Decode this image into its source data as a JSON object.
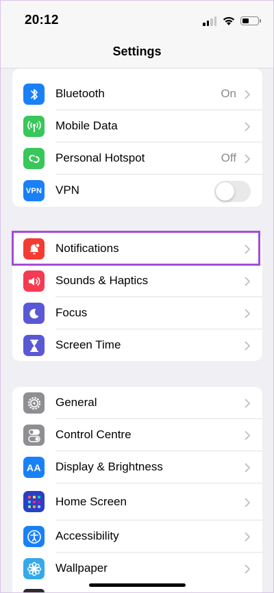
{
  "status_bar": {
    "time": "20:12",
    "icons": [
      "cellular-signal-icon",
      "wifi-icon",
      "battery-icon"
    ]
  },
  "nav": {
    "title": "Settings"
  },
  "groups": [
    {
      "rows": [
        {
          "label": "Bluetooth",
          "value": "On",
          "icon": "bluetooth-icon",
          "icon_color": "#1a80f7"
        },
        {
          "label": "Mobile Data",
          "value": "",
          "icon": "antenna-icon",
          "icon_color": "#38c759"
        },
        {
          "label": "Personal Hotspot",
          "value": "Off",
          "icon": "hotspot-icon",
          "icon_color": "#38c759"
        },
        {
          "label": "VPN",
          "value": "",
          "icon": "vpn-icon",
          "icon_text": "VPN",
          "icon_color": "#1a80f7",
          "toggle_on": false
        }
      ]
    },
    {
      "rows": [
        {
          "label": "Notifications",
          "icon": "bell-icon",
          "icon_color": "#f43b32",
          "highlighted": true
        },
        {
          "label": "Sounds & Haptics",
          "icon": "speaker-icon",
          "icon_color": "#f43b52"
        },
        {
          "label": "Focus",
          "icon": "moon-icon",
          "icon_color": "#5b58d6"
        },
        {
          "label": "Screen Time",
          "icon": "hourglass-icon",
          "icon_color": "#5b58d6"
        }
      ]
    },
    {
      "rows": [
        {
          "label": "General",
          "icon": "gear-icon",
          "icon_color": "#8e8e93"
        },
        {
          "label": "Control Centre",
          "icon": "toggles-icon",
          "icon_color": "#8e8e93"
        },
        {
          "label": "Display & Brightness",
          "icon": "text-size-icon",
          "icon_text": "AA",
          "icon_color": "#1a80f7"
        },
        {
          "label": "Home Screen",
          "icon": "home-grid-icon",
          "icon_color": "#2a3fc7"
        },
        {
          "label": "Accessibility",
          "icon": "accessibility-icon",
          "icon_color": "#1a80f7"
        },
        {
          "label": "Wallpaper",
          "icon": "flower-icon",
          "icon_color": "#36a9e8"
        }
      ]
    }
  ],
  "colors": {
    "highlight": "#a64bd8",
    "background": "#efeff4"
  }
}
